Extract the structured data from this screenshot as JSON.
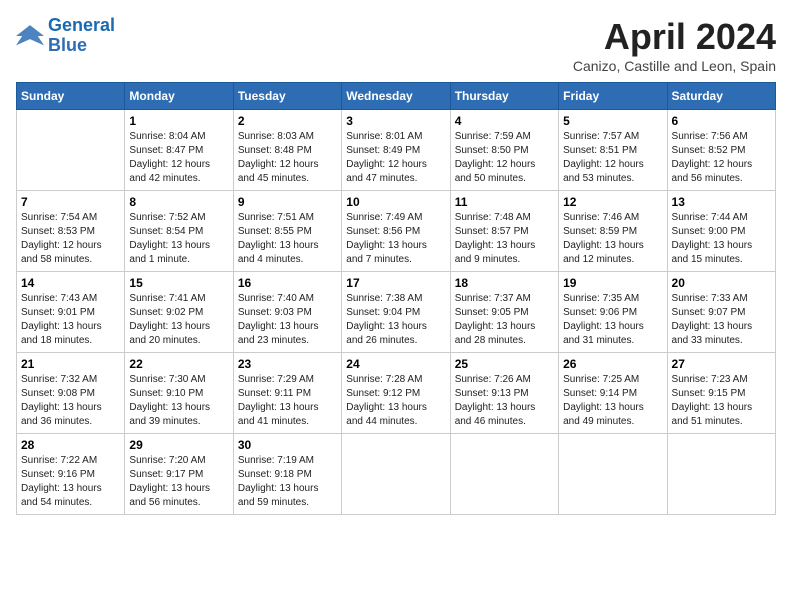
{
  "logo": {
    "line1": "General",
    "line2": "Blue"
  },
  "title": "April 2024",
  "subtitle": "Canizo, Castille and Leon, Spain",
  "weekdays": [
    "Sunday",
    "Monday",
    "Tuesday",
    "Wednesday",
    "Thursday",
    "Friday",
    "Saturday"
  ],
  "weeks": [
    [
      {
        "day": "",
        "info": ""
      },
      {
        "day": "1",
        "info": "Sunrise: 8:04 AM\nSunset: 8:47 PM\nDaylight: 12 hours\nand 42 minutes."
      },
      {
        "day": "2",
        "info": "Sunrise: 8:03 AM\nSunset: 8:48 PM\nDaylight: 12 hours\nand 45 minutes."
      },
      {
        "day": "3",
        "info": "Sunrise: 8:01 AM\nSunset: 8:49 PM\nDaylight: 12 hours\nand 47 minutes."
      },
      {
        "day": "4",
        "info": "Sunrise: 7:59 AM\nSunset: 8:50 PM\nDaylight: 12 hours\nand 50 minutes."
      },
      {
        "day": "5",
        "info": "Sunrise: 7:57 AM\nSunset: 8:51 PM\nDaylight: 12 hours\nand 53 minutes."
      },
      {
        "day": "6",
        "info": "Sunrise: 7:56 AM\nSunset: 8:52 PM\nDaylight: 12 hours\nand 56 minutes."
      }
    ],
    [
      {
        "day": "7",
        "info": "Sunrise: 7:54 AM\nSunset: 8:53 PM\nDaylight: 12 hours\nand 58 minutes."
      },
      {
        "day": "8",
        "info": "Sunrise: 7:52 AM\nSunset: 8:54 PM\nDaylight: 13 hours\nand 1 minute."
      },
      {
        "day": "9",
        "info": "Sunrise: 7:51 AM\nSunset: 8:55 PM\nDaylight: 13 hours\nand 4 minutes."
      },
      {
        "day": "10",
        "info": "Sunrise: 7:49 AM\nSunset: 8:56 PM\nDaylight: 13 hours\nand 7 minutes."
      },
      {
        "day": "11",
        "info": "Sunrise: 7:48 AM\nSunset: 8:57 PM\nDaylight: 13 hours\nand 9 minutes."
      },
      {
        "day": "12",
        "info": "Sunrise: 7:46 AM\nSunset: 8:59 PM\nDaylight: 13 hours\nand 12 minutes."
      },
      {
        "day": "13",
        "info": "Sunrise: 7:44 AM\nSunset: 9:00 PM\nDaylight: 13 hours\nand 15 minutes."
      }
    ],
    [
      {
        "day": "14",
        "info": "Sunrise: 7:43 AM\nSunset: 9:01 PM\nDaylight: 13 hours\nand 18 minutes."
      },
      {
        "day": "15",
        "info": "Sunrise: 7:41 AM\nSunset: 9:02 PM\nDaylight: 13 hours\nand 20 minutes."
      },
      {
        "day": "16",
        "info": "Sunrise: 7:40 AM\nSunset: 9:03 PM\nDaylight: 13 hours\nand 23 minutes."
      },
      {
        "day": "17",
        "info": "Sunrise: 7:38 AM\nSunset: 9:04 PM\nDaylight: 13 hours\nand 26 minutes."
      },
      {
        "day": "18",
        "info": "Sunrise: 7:37 AM\nSunset: 9:05 PM\nDaylight: 13 hours\nand 28 minutes."
      },
      {
        "day": "19",
        "info": "Sunrise: 7:35 AM\nSunset: 9:06 PM\nDaylight: 13 hours\nand 31 minutes."
      },
      {
        "day": "20",
        "info": "Sunrise: 7:33 AM\nSunset: 9:07 PM\nDaylight: 13 hours\nand 33 minutes."
      }
    ],
    [
      {
        "day": "21",
        "info": "Sunrise: 7:32 AM\nSunset: 9:08 PM\nDaylight: 13 hours\nand 36 minutes."
      },
      {
        "day": "22",
        "info": "Sunrise: 7:30 AM\nSunset: 9:10 PM\nDaylight: 13 hours\nand 39 minutes."
      },
      {
        "day": "23",
        "info": "Sunrise: 7:29 AM\nSunset: 9:11 PM\nDaylight: 13 hours\nand 41 minutes."
      },
      {
        "day": "24",
        "info": "Sunrise: 7:28 AM\nSunset: 9:12 PM\nDaylight: 13 hours\nand 44 minutes."
      },
      {
        "day": "25",
        "info": "Sunrise: 7:26 AM\nSunset: 9:13 PM\nDaylight: 13 hours\nand 46 minutes."
      },
      {
        "day": "26",
        "info": "Sunrise: 7:25 AM\nSunset: 9:14 PM\nDaylight: 13 hours\nand 49 minutes."
      },
      {
        "day": "27",
        "info": "Sunrise: 7:23 AM\nSunset: 9:15 PM\nDaylight: 13 hours\nand 51 minutes."
      }
    ],
    [
      {
        "day": "28",
        "info": "Sunrise: 7:22 AM\nSunset: 9:16 PM\nDaylight: 13 hours\nand 54 minutes."
      },
      {
        "day": "29",
        "info": "Sunrise: 7:20 AM\nSunset: 9:17 PM\nDaylight: 13 hours\nand 56 minutes."
      },
      {
        "day": "30",
        "info": "Sunrise: 7:19 AM\nSunset: 9:18 PM\nDaylight: 13 hours\nand 59 minutes."
      },
      {
        "day": "",
        "info": ""
      },
      {
        "day": "",
        "info": ""
      },
      {
        "day": "",
        "info": ""
      },
      {
        "day": "",
        "info": ""
      }
    ]
  ]
}
